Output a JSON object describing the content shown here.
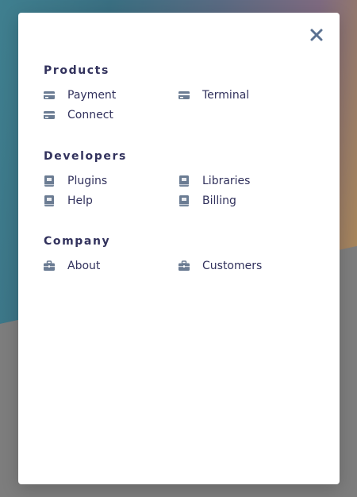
{
  "modal": {
    "close_icon": "close-icon",
    "sections": [
      {
        "title": "Products",
        "icon": "credit-card-icon",
        "links": [
          "Payment",
          "Terminal",
          "Connect"
        ]
      },
      {
        "title": "Developers",
        "icon": "book-icon",
        "links": [
          "Plugins",
          "Libraries",
          "Help",
          "Billing"
        ]
      },
      {
        "title": "Company",
        "icon": "briefcase-icon",
        "links": [
          "About",
          "Customers"
        ]
      }
    ]
  },
  "colors": {
    "heading": "#32325d",
    "icon": "#6b7c93",
    "close": "#5b7191"
  }
}
